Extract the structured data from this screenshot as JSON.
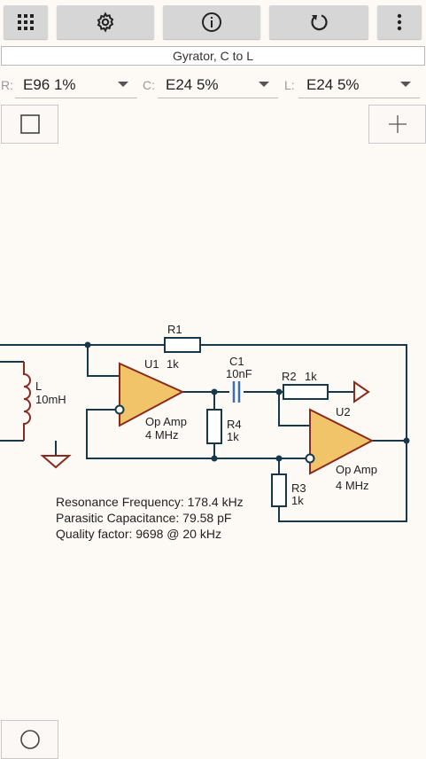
{
  "toolbar": {
    "buttons": [
      {
        "name": "grid-menu",
        "icon": "grid-icon"
      },
      {
        "name": "settings",
        "icon": "gear-icon"
      },
      {
        "name": "info",
        "icon": "info-icon"
      },
      {
        "name": "reset",
        "icon": "refresh-icon"
      },
      {
        "name": "overflow-menu",
        "icon": "more-vertical-icon"
      }
    ]
  },
  "title": "Gyrator, C to L",
  "series_selectors": [
    {
      "label": "R:",
      "value": "E96 1%"
    },
    {
      "label": "C:",
      "value": "E24 5%"
    },
    {
      "label": "L:",
      "value": "E24 5%"
    }
  ],
  "schematic": {
    "R1": {
      "name": "R1",
      "value": "1k"
    },
    "R2": {
      "name": "R2",
      "value": "1k"
    },
    "R3": {
      "name": "R3",
      "value": "1k"
    },
    "R4": {
      "name": "R4",
      "value": "1k"
    },
    "C1": {
      "name": "C1",
      "value": "10nF"
    },
    "L": {
      "name": "L",
      "value": "10mH"
    },
    "U1": {
      "name": "U1",
      "type": "Op Amp",
      "bandwidth": "4 MHz"
    },
    "U2": {
      "name": "U2",
      "type": "Op Amp",
      "bandwidth": "4 MHz"
    }
  },
  "results": {
    "resonance": "Resonance Frequency: 178.4 kHz",
    "parasitic": "Parasitic Capacitance: 79.58 pF",
    "quality": "Quality factor: 9698 @ 20 kHz"
  },
  "colors": {
    "background": "#fdf9f5",
    "opamp_fill": "#f2c46a",
    "opamp_stroke": "#8a2a1e",
    "capacitor": "#3a6fb0",
    "wire": "#16384a",
    "inductor": "#8a2a1e"
  }
}
